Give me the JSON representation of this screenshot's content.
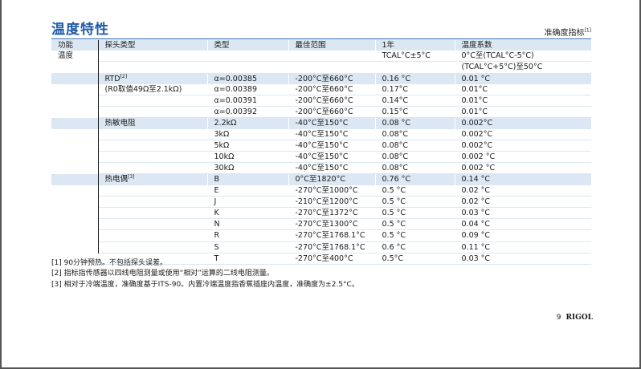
{
  "header": {
    "title": "温度特性",
    "subtitle": "准确度指标",
    "subtitle_note": "[1]"
  },
  "table": {
    "columns": [
      "功能",
      "探头类型",
      "类型",
      "最佳范围",
      "1年",
      "温度系数"
    ],
    "rows": [
      {
        "func": "温度",
        "probe": "",
        "probe_note": "",
        "type": "",
        "range": "",
        "year": "TCAL°C±5°C",
        "coef": "0°C至(TCAL°C-5°C)",
        "shade": false
      },
      {
        "func": "",
        "probe": "",
        "probe_note": "",
        "type": "",
        "range": "",
        "year": "",
        "coef": "(TCAL°C+5°C)至50°C",
        "shade": false
      },
      {
        "func": "",
        "probe": "RTD",
        "probe_note": "[2]",
        "type": "α=0.00385",
        "range": "-200°C至660°C",
        "year": "0.16 °C",
        "coef": "0.01 °C",
        "shade": true
      },
      {
        "func": "",
        "probe": "(R0取值49Ω至2.1kΩ)",
        "probe_note": "",
        "type": "α=0.00389",
        "range": "-200°C至660°C",
        "year": "0.17°C",
        "coef": "0.01°C",
        "shade": false
      },
      {
        "func": "",
        "probe": "",
        "probe_note": "",
        "type": "α=0.00391",
        "range": "-200°C至660°C",
        "year": "0.14°C",
        "coef": "0.01°C",
        "shade": false
      },
      {
        "func": "",
        "probe": "",
        "probe_note": "",
        "type": "α=0.00392",
        "range": "-200°C至660°C",
        "year": "0.15°C",
        "coef": "0.01°C",
        "shade": false
      },
      {
        "func": "",
        "probe": "热敏电阻",
        "probe_note": "",
        "type": "2.2kΩ",
        "range": "-40°C至150°C",
        "year": "0.08 °C",
        "coef": "0.002°C",
        "shade": true
      },
      {
        "func": "",
        "probe": "",
        "probe_note": "",
        "type": "3kΩ",
        "range": "-40°C至150°C",
        "year": "0.08°C",
        "coef": "0.002°C",
        "shade": false
      },
      {
        "func": "",
        "probe": "",
        "probe_note": "",
        "type": "5kΩ",
        "range": "-40°C至150°C",
        "year": "0.08°C",
        "coef": "0.002°C",
        "shade": false
      },
      {
        "func": "",
        "probe": "",
        "probe_note": "",
        "type": "10kΩ",
        "range": "-40°C至150°C",
        "year": "0.08°C",
        "coef": "0.002 °C",
        "shade": false
      },
      {
        "func": "",
        "probe": "",
        "probe_note": "",
        "type": "30kΩ",
        "range": "-40°C至150°C",
        "year": "0.08°C",
        "coef": "0.002 °C",
        "shade": false
      },
      {
        "func": "",
        "probe": "热电偶",
        "probe_note": "[3]",
        "type": "B",
        "range": "0°C至1820°C",
        "year": "0.76 °C",
        "coef": "0.14 °C",
        "shade": true
      },
      {
        "func": "",
        "probe": "",
        "probe_note": "",
        "type": "E",
        "range": "-270°C至1000°C",
        "year": "0.5 °C",
        "coef": "0.02 °C",
        "shade": false
      },
      {
        "func": "",
        "probe": "",
        "probe_note": "",
        "type": "J",
        "range": "-210°C至1200°C",
        "year": "0.5 °C",
        "coef": "0.02 °C",
        "shade": false
      },
      {
        "func": "",
        "probe": "",
        "probe_note": "",
        "type": "K",
        "range": "-270°C至1372°C",
        "year": "0.5 °C",
        "coef": "0.03 °C",
        "shade": false
      },
      {
        "func": "",
        "probe": "",
        "probe_note": "",
        "type": "N",
        "range": "-270°C至1300°C",
        "year": "0.5 °C",
        "coef": "0.04 °C",
        "shade": false
      },
      {
        "func": "",
        "probe": "",
        "probe_note": "",
        "type": "R",
        "range": "-270°C至1768.1°C",
        "year": "0.5 °C",
        "coef": "0.09 °C",
        "shade": false
      },
      {
        "func": "",
        "probe": "",
        "probe_note": "",
        "type": "S",
        "range": "-270°C至1768.1°C",
        "year": "0.6 °C",
        "coef": "0.11 °C",
        "shade": false
      },
      {
        "func": "",
        "probe": "",
        "probe_note": "",
        "type": "T",
        "range": "-270°C至400°C",
        "year": "0.5°C",
        "coef": "0.03 °C",
        "shade": false
      }
    ]
  },
  "notes": [
    "[1] 90分钟预热。不包括探头误差。",
    "[2] 指标指传感器以四线电阻测量或使用“相对”运算的二线电阻测量。",
    "[3] 相对于冷端温度，准确度基于ITS-90。内置冷端温度指香蕉插座内温度，准确度为±2.5°C。"
  ],
  "footer": {
    "page_number": "9",
    "brand": "RIGOL"
  },
  "colors": {
    "title": "#1f5aa8",
    "row_shade": "#dbe7f2"
  }
}
